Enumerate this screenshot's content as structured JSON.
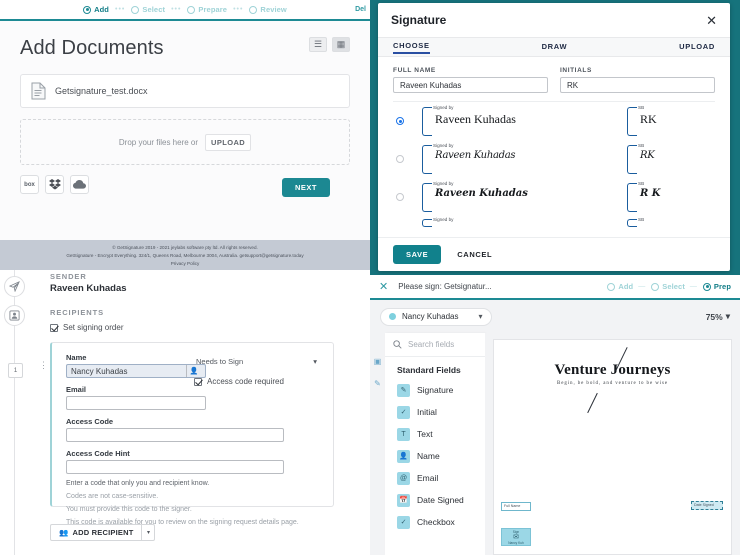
{
  "add_panel": {
    "wizard": {
      "steps": [
        {
          "label": "Add",
          "state": "active"
        },
        {
          "label": "Select",
          "state": "inactive"
        },
        {
          "label": "Prepare",
          "state": "inactive"
        },
        {
          "label": "Review",
          "state": "inactive"
        }
      ],
      "dots": "•••",
      "right_link": "Del"
    },
    "title": "Add Documents",
    "view_list_icon": "list-view-icon",
    "view_grid_icon": "grid-view-icon",
    "document": {
      "name": "Getsignature_test.docx",
      "icon": "docx-file-icon"
    },
    "dropzone": {
      "text": "Drop your files here or",
      "upload_label": "UPLOAD"
    },
    "cloud_sources": [
      {
        "label": "box",
        "name": "box-source"
      },
      {
        "label": "",
        "name": "dropbox-source"
      },
      {
        "label": "",
        "name": "onedrive-source"
      }
    ],
    "next_label": "NEXT",
    "footer": [
      "© GetSignature 2019 - 2021 jeylabs software pty ltd. All rights reserved.",
      "GetSignature - Encrypt Everything. 324/1, Queens Road, Melbourne 3004, Australia. getsupport@getsignature.today",
      "Privacy Policy"
    ]
  },
  "recipients_panel": {
    "sender_label": "SENDER",
    "sender_name": "Raveen Kuhadas",
    "recipients_label": "RECIPIENTS",
    "signing_order_label": "Set signing order",
    "signing_order_checked": true,
    "order_number": "1",
    "name_label": "Name",
    "name_value": "Nancy Kuhadas",
    "email_label": "Email",
    "email_value": "",
    "access_code_label": "Access Code",
    "access_code_value": "",
    "access_code_hint_label": "Access Code Hint",
    "access_code_hint_value": "",
    "role_value": "Needs to Sign",
    "access_code_required_label": "Access code required",
    "access_code_required_checked": true,
    "help_lines": [
      "Enter a code that only you and recipient know.",
      "Codes are not case-sensitive.",
      "You must provide this code to the signer.",
      "This code is available for you to review on the signing request details page."
    ],
    "add_recipient_label": "ADD RECIPIENT"
  },
  "signature_modal": {
    "title": "Signature",
    "close_icon": "close-icon",
    "tabs": [
      {
        "label": "CHOOSE",
        "selected": true
      },
      {
        "label": "DRAW",
        "selected": false
      },
      {
        "label": "UPLOAD",
        "selected": false
      }
    ],
    "full_name_label": "FULL NAME",
    "full_name_value": "Raveen Kuhadas",
    "initials_label": "INITIALS",
    "initials_value": "RK",
    "signed_by_tag": "Signed by",
    "initials_tag": "SB",
    "options": [
      {
        "signature": "Raveen Kuhadas",
        "initials": "RK",
        "selected": true,
        "style": "s1"
      },
      {
        "signature": "Raveen Kuhadas",
        "initials": "RK",
        "selected": false,
        "style": "s2"
      },
      {
        "signature": "Raveen  Kuhadas",
        "initials": "R K",
        "selected": false,
        "style": "s3"
      }
    ],
    "save_label": "SAVE",
    "cancel_label": "CANCEL"
  },
  "signing_panel": {
    "close_icon": "close-icon",
    "doc_title": "Please sign: Getsignatur...",
    "wizard": [
      {
        "label": "Add",
        "state": "done"
      },
      {
        "label": "Select",
        "state": "done"
      },
      {
        "label": "Prep",
        "state": "active"
      }
    ],
    "recipient": "Nancy Kuhadas",
    "zoom_level": "75%",
    "search_placeholder": "Search fields",
    "search_icon": "search-icon",
    "standard_fields_label": "Standard Fields",
    "fields": [
      {
        "label": "Signature",
        "icon": "signature-icon"
      },
      {
        "label": "Initial",
        "icon": "initial-icon"
      },
      {
        "label": "Text",
        "icon": "text-icon"
      },
      {
        "label": "Name",
        "icon": "name-icon"
      },
      {
        "label": "Email",
        "icon": "email-icon"
      },
      {
        "label": "Date Signed",
        "icon": "calendar-icon"
      },
      {
        "label": "Checkbox",
        "icon": "checkbox-icon"
      }
    ],
    "document": {
      "title": "Venture Journeys",
      "subtitle": "Begin, be bold, and venture to be wise",
      "placeholders": [
        {
          "label": "Full Name",
          "name": "full-name-placeholder"
        },
        {
          "label": "Date Signed",
          "name": "date-signed-placeholder"
        }
      ],
      "signature_chip": {
        "top": "Sign",
        "bottom": "Nancy Kuh"
      }
    }
  },
  "colors": {
    "teal": "#1c8892",
    "teal_dark": "#16737c",
    "blue_accent": "#2a4fa2",
    "field_blue": "#9bd7e6"
  }
}
